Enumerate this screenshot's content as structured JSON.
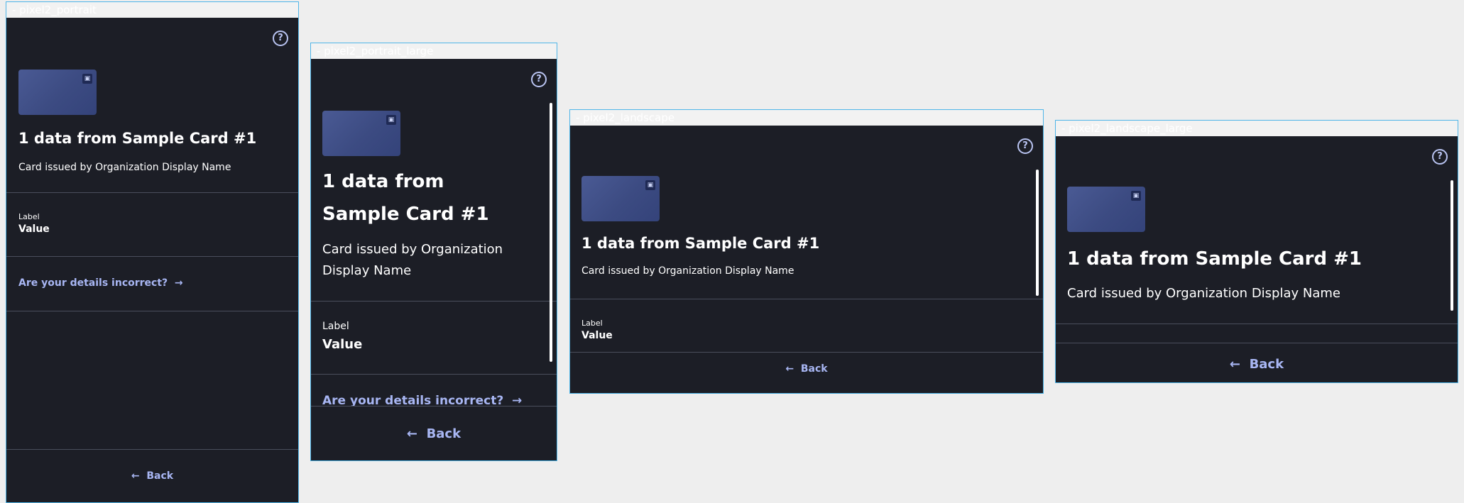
{
  "frames": [
    {
      "label": "- pixel2_portrait"
    },
    {
      "label": "- pixel2_portrait_large"
    },
    {
      "label": "- pixel2_landscape"
    },
    {
      "label": "- pixel2_landscape_large"
    }
  ],
  "content": {
    "help_icon": "help-circle-icon",
    "card_image_icon": "card-thumbnail-icon",
    "title": "1 data from Sample Card #1",
    "subtitle": "Card issued by Organization Display Name",
    "field_label": "Label",
    "field_value": "Value",
    "incorrect_link": "Are your details incorrect?",
    "back_label": "Back",
    "help_glyph": "?",
    "forward_glyph": "→",
    "back_glyph": "←"
  },
  "colors": {
    "background": "#1c1e26",
    "accent": "#a8b6f3",
    "divider": "#4a4e5c",
    "frame_border": "#4fb5e8"
  }
}
